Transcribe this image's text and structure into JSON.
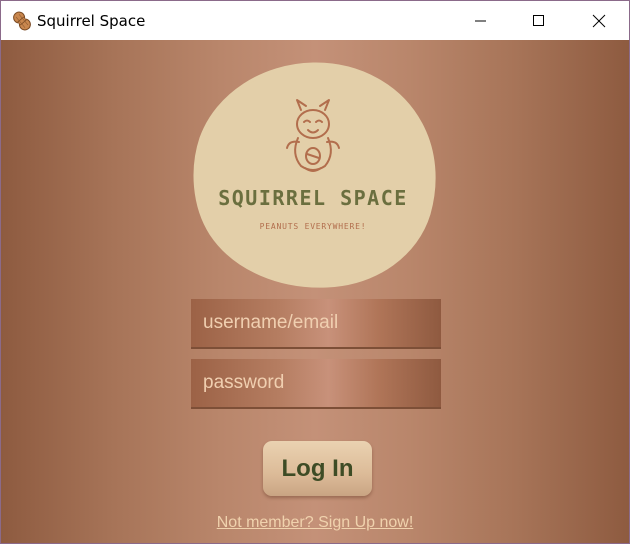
{
  "window": {
    "title": "Squirrel Space",
    "icons": {
      "app": "peanut-icon",
      "minimize": "minimize-icon",
      "maximize": "maximize-icon",
      "close": "close-icon"
    }
  },
  "logo": {
    "icon": "squirrel-icon",
    "title": "SQUIRREL SPACE",
    "tagline": "PEANUTS EVERYWHERE!"
  },
  "form": {
    "username_placeholder": "username/email",
    "password_placeholder": "password",
    "login_label": "Log In",
    "signup_link": "Not member? Sign Up now!"
  },
  "colors": {
    "background_edge": "#8e5b40",
    "background_center": "#c49178",
    "logo_circle": "#e3cfa9",
    "logo_title": "#6b6f3f",
    "logo_tagline": "#b26e4d",
    "button": "#dcbb98",
    "button_text": "#3e4c25",
    "link": "#f0d2ad"
  }
}
